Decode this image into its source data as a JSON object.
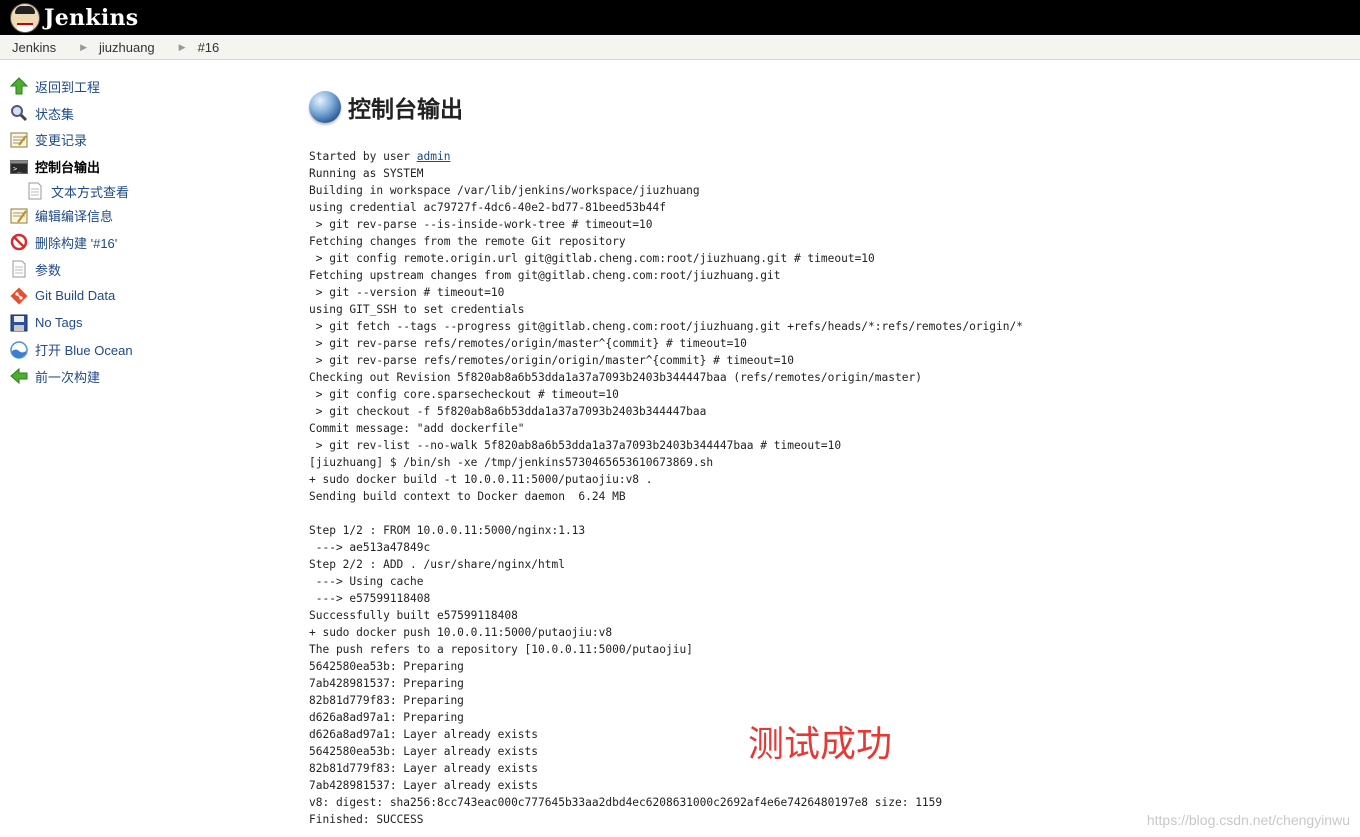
{
  "header": {
    "logo_text": "Jenkins"
  },
  "breadcrumb": [
    "Jenkins",
    "jiuzhuang",
    "#16"
  ],
  "sidebar": {
    "items": [
      {
        "label": "返回到工程",
        "icon": "up-arrow-icon"
      },
      {
        "label": "状态集",
        "icon": "magnifier-icon"
      },
      {
        "label": "变更记录",
        "icon": "notepad-icon"
      },
      {
        "label": "控制台输出",
        "icon": "terminal-icon",
        "active": true
      },
      {
        "label": "文本方式查看",
        "icon": "document-icon",
        "sub": true
      },
      {
        "label": "编辑编译信息",
        "icon": "notepad-edit-icon"
      },
      {
        "label": "删除构建 '#16'",
        "icon": "no-entry-icon"
      },
      {
        "label": "参数",
        "icon": "document-icon"
      },
      {
        "label": "Git Build Data",
        "icon": "git-icon"
      },
      {
        "label": "No Tags",
        "icon": "floppy-icon"
      },
      {
        "label": "打开 Blue Ocean",
        "icon": "blue-ocean-icon"
      },
      {
        "label": "前一次构建",
        "icon": "left-arrow-icon"
      }
    ]
  },
  "main": {
    "title": "控制台输出",
    "console_prefix": "Started by user ",
    "console_user": "admin",
    "console_lines": [
      "Running as SYSTEM",
      "Building in workspace /var/lib/jenkins/workspace/jiuzhuang",
      "using credential ac79727f-4dc6-40e2-bd77-81beed53b44f",
      " > git rev-parse --is-inside-work-tree # timeout=10",
      "Fetching changes from the remote Git repository",
      " > git config remote.origin.url git@gitlab.cheng.com:root/jiuzhuang.git # timeout=10",
      "Fetching upstream changes from git@gitlab.cheng.com:root/jiuzhuang.git",
      " > git --version # timeout=10",
      "using GIT_SSH to set credentials",
      " > git fetch --tags --progress git@gitlab.cheng.com:root/jiuzhuang.git +refs/heads/*:refs/remotes/origin/*",
      " > git rev-parse refs/remotes/origin/master^{commit} # timeout=10",
      " > git rev-parse refs/remotes/origin/origin/master^{commit} # timeout=10",
      "Checking out Revision 5f820ab8a6b53dda1a37a7093b2403b344447baa (refs/remotes/origin/master)",
      " > git config core.sparsecheckout # timeout=10",
      " > git checkout -f 5f820ab8a6b53dda1a37a7093b2403b344447baa",
      "Commit message: \"add dockerfile\"",
      " > git rev-list --no-walk 5f820ab8a6b53dda1a37a7093b2403b344447baa # timeout=10",
      "[jiuzhuang] $ /bin/sh -xe /tmp/jenkins5730465653610673869.sh",
      "+ sudo docker build -t 10.0.0.11:5000/putaojiu:v8 .",
      "Sending build context to Docker daemon  6.24 MB",
      "",
      "Step 1/2 : FROM 10.0.0.11:5000/nginx:1.13",
      " ---> ae513a47849c",
      "Step 2/2 : ADD . /usr/share/nginx/html",
      " ---> Using cache",
      " ---> e57599118408",
      "Successfully built e57599118408",
      "+ sudo docker push 10.0.0.11:5000/putaojiu:v8",
      "The push refers to a repository [10.0.0.11:5000/putaojiu]",
      "5642580ea53b: Preparing",
      "7ab428981537: Preparing",
      "82b81d779f83: Preparing",
      "d626a8ad97a1: Preparing",
      "d626a8ad97a1: Layer already exists",
      "5642580ea53b: Layer already exists",
      "82b81d779f83: Layer already exists",
      "7ab428981537: Layer already exists",
      "v8: digest: sha256:8cc743eac000c777645b33aa2dbd4ec6208631000c2692af4e6e7426480197e8 size: 1159",
      "Finished: SUCCESS"
    ]
  },
  "annotation": "测试成功",
  "watermark": "https://blog.csdn.net/chengyinwu",
  "colors": {
    "link": "#204a87",
    "annotation": "#e53935",
    "header_bg": "#000000"
  }
}
